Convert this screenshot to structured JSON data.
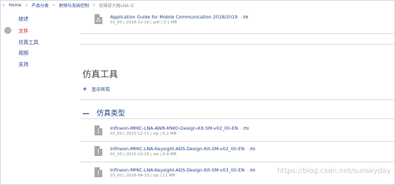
{
  "breadcrumb": [
    "Home",
    "产品分类",
    "射频与无线控制",
    "低噪放大器LNA IC"
  ],
  "sidebar": {
    "items": [
      "综述",
      "文件",
      "仿真工具",
      "视频",
      "支持"
    ],
    "active_index": 1
  },
  "docs_file": {
    "name": "Application Guide for Mobile Communication 2018/2019",
    "lang": "EN",
    "meta": "01_00 | 2018-12-16 | pdf | 3.1 MB"
  },
  "tools_section": {
    "title": "仿真工具",
    "show_all": "显示所有",
    "subsection": "仿真类型"
  },
  "sim_files": [
    {
      "name": "Infineon-MMIC-LNA-AWR-MWO-Design-Kit-SM-v02_00-EN",
      "lang": "EN",
      "meta": "02_00 | 2015-12-11 | zip | 6.2 MB"
    },
    {
      "name": "Infineon-MMIC-LNA-Keysight-ADS-Design-Kit-SM-v02_00-EN",
      "lang": "EN",
      "meta": "02_00 | 2015-10-26 | zip | 9.9 MB"
    },
    {
      "name": "Infineon-MMIC-LNA-Keysight-ADS-Design-Kit-SM-v03_00-EN",
      "lang": "EN",
      "meta": "03_00 | 2018-04-10 | zip | 11 MB"
    }
  ],
  "watermark": "https://blog.csdn.net/sunskyday",
  "colors": {
    "link": "#1f3e8a",
    "active": "#d6003a",
    "icon_gray": "#a8a8a8"
  }
}
